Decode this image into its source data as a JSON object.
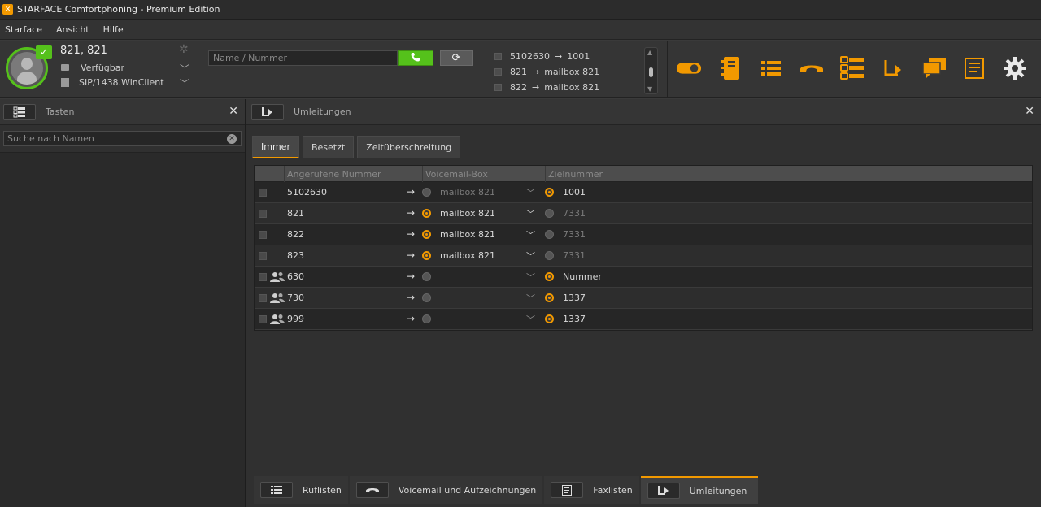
{
  "window": {
    "title": "STARFACE Comfortphoning - Premium Edition"
  },
  "menu": {
    "items": [
      "Starface",
      "Ansicht",
      "Hilfe"
    ]
  },
  "user": {
    "name": "821, 821",
    "status": "Verfügbar",
    "device": "SIP/1438.WinClient"
  },
  "dial": {
    "placeholder": "Name / Nummer"
  },
  "summary": {
    "lines": [
      {
        "from": "5102630",
        "to": "1001"
      },
      {
        "from": "821",
        "to": "mailbox 821"
      },
      {
        "from": "822",
        "to": "mailbox 821"
      }
    ]
  },
  "toolbar": {
    "icons": [
      "toggle-icon",
      "contacts-icon",
      "list-icon",
      "phone-hangup-icon",
      "buttons-list-icon",
      "redirect-icon",
      "chat-icon",
      "fax-icon",
      "settings-gear-icon"
    ],
    "accent": "#f29900"
  },
  "left_panel": {
    "title": "Tasten",
    "search_placeholder": "Suche nach Namen"
  },
  "main_panel": {
    "title": "Umleitungen",
    "tabs": [
      "Immer",
      "Besetzt",
      "Zeitüberschreitung"
    ],
    "active_tab": "Immer",
    "columns": [
      "Angerufene Nummer",
      "Voicemail-Box",
      "Zielnummer"
    ],
    "rows": [
      {
        "group": false,
        "number": "5102630",
        "voicemail_selected": false,
        "mailbox": "mailbox 821",
        "target_selected": true,
        "target": "1001"
      },
      {
        "group": false,
        "number": "821",
        "voicemail_selected": true,
        "mailbox": "mailbox 821",
        "target_selected": false,
        "target": "7331"
      },
      {
        "group": false,
        "number": "822",
        "voicemail_selected": true,
        "mailbox": "mailbox 821",
        "target_selected": false,
        "target": "7331"
      },
      {
        "group": false,
        "number": "823",
        "voicemail_selected": true,
        "mailbox": "mailbox 821",
        "target_selected": false,
        "target": "7331"
      },
      {
        "group": true,
        "number": "630",
        "voicemail_selected": false,
        "mailbox": "",
        "target_selected": true,
        "target": "Nummer"
      },
      {
        "group": true,
        "number": "730",
        "voicemail_selected": false,
        "mailbox": "",
        "target_selected": true,
        "target": "1337"
      },
      {
        "group": true,
        "number": "999",
        "voicemail_selected": false,
        "mailbox": "",
        "target_selected": true,
        "target": "1337"
      }
    ]
  },
  "bottom_tabs": {
    "items": [
      "Ruflisten",
      "Voicemail und Aufzeichnungen",
      "Faxlisten",
      "Umleitungen"
    ],
    "active": "Umleitungen"
  },
  "colors": {
    "accent": "#f29900",
    "online": "#55c11b"
  }
}
